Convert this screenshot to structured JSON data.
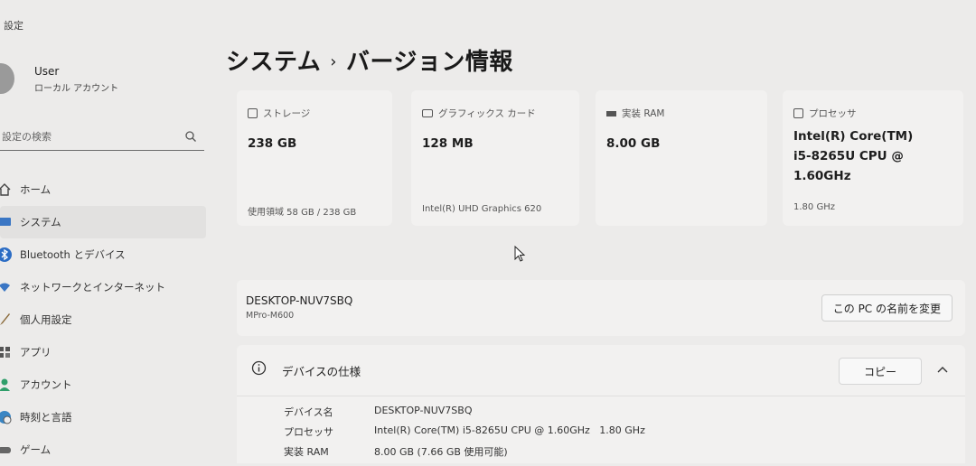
{
  "app": {
    "title": "設定"
  },
  "user": {
    "name": "User",
    "account_type": "ローカル アカウント"
  },
  "search": {
    "placeholder": "設定の検索"
  },
  "sidebar": {
    "items": [
      {
        "label": "ホーム",
        "icon": "home-icon"
      },
      {
        "label": "システム",
        "icon": "system-icon",
        "active": true
      },
      {
        "label": "Bluetooth とデバイス",
        "icon": "bluetooth-icon"
      },
      {
        "label": "ネットワークとインターネット",
        "icon": "wifi-icon"
      },
      {
        "label": "個人用設定",
        "icon": "brush-icon"
      },
      {
        "label": "アプリ",
        "icon": "apps-icon"
      },
      {
        "label": "アカウント",
        "icon": "account-icon"
      },
      {
        "label": "時刻と言語",
        "icon": "globe-clock-icon"
      },
      {
        "label": "ゲーム",
        "icon": "gamepad-icon"
      }
    ]
  },
  "breadcrumb": {
    "parent": "システム",
    "separator": "›",
    "current": "バージョン情報"
  },
  "cards": [
    {
      "label": "ストレージ",
      "value": "238 GB",
      "sub": "使用領域 58 GB / 238 GB",
      "icon": "storage-icon"
    },
    {
      "label": "グラフィックス カード",
      "value": "128 MB",
      "sub": "Intel(R) UHD Graphics 620",
      "icon": "graphics-card-icon"
    },
    {
      "label": "実装 RAM",
      "value": "8.00 GB",
      "sub": "",
      "icon": "ram-icon"
    },
    {
      "label": "プロセッサ",
      "value": "Intel(R) Core(TM) i5-8265U CPU @ 1.60GHz",
      "sub": "1.80 GHz",
      "icon": "processor-icon"
    }
  ],
  "device": {
    "name": "DESKTOP-NUV7SBQ",
    "model": "MPro-M600",
    "rename_label": "この PC の名前を変更"
  },
  "specs": {
    "title": "デバイスの仕様",
    "copy_label": "コピー",
    "rows": [
      {
        "key": "デバイス名",
        "value": "DESKTOP-NUV7SBQ"
      },
      {
        "key": "プロセッサ",
        "value": "Intel(R) Core(TM) i5-8265U CPU @ 1.60GHz   1.80 GHz"
      },
      {
        "key": "実装 RAM",
        "value": "8.00 GB (7.66 GB 使用可能)"
      }
    ]
  }
}
